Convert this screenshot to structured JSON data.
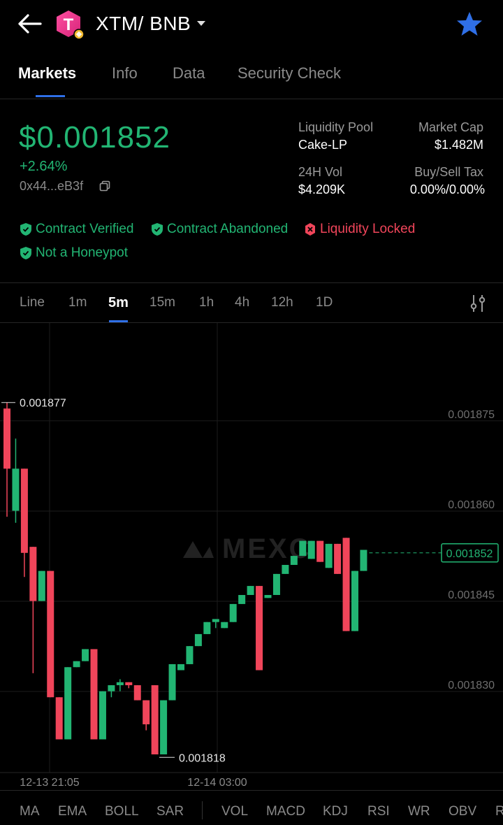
{
  "header": {
    "title": "XTM/ BNB",
    "logo_letter": "T",
    "starred": true
  },
  "tabs": [
    {
      "label": "Markets",
      "active": true
    },
    {
      "label": "Info",
      "active": false
    },
    {
      "label": "Data",
      "active": false
    },
    {
      "label": "Security Check",
      "active": false
    }
  ],
  "market": {
    "price": "$0.001852",
    "change": "+2.64%",
    "address": "0x44...eB3f",
    "liquidity_pool_label": "Liquidity Pool",
    "liquidity_pool_value": "Cake-LP",
    "market_cap_label": "Market Cap",
    "market_cap_value": "$1.482M",
    "vol_label": "24H Vol",
    "vol_value": "$4.209K",
    "tax_label": "Buy/Sell Tax",
    "tax_value": "0.00%/0.00%"
  },
  "badges": [
    {
      "label": "Contract Verified",
      "status": "ok"
    },
    {
      "label": "Contract Abandoned",
      "status": "ok"
    },
    {
      "label": "Liquidity Locked",
      "status": "bad"
    },
    {
      "label": "Not a Honeypot",
      "status": "ok"
    }
  ],
  "timeframes": [
    {
      "label": "Line",
      "active": false
    },
    {
      "label": "1m",
      "active": false
    },
    {
      "label": "5m",
      "active": true
    },
    {
      "label": "15m",
      "active": false
    },
    {
      "label": "1h",
      "active": false
    },
    {
      "label": "4h",
      "active": false
    },
    {
      "label": "12h",
      "active": false
    },
    {
      "label": "1D",
      "active": false
    }
  ],
  "indicators": [
    "MA",
    "EMA",
    "BOLL",
    "SAR",
    "VOL",
    "MACD",
    "KDJ",
    "RSI",
    "WR",
    "OBV",
    "R"
  ],
  "colors": {
    "up": "#22b573",
    "down": "#f0455a",
    "accent": "#2f6fe6",
    "background": "#000000"
  },
  "chart_data": {
    "type": "candlestick",
    "watermark": "MEXC",
    "y_ticks": [
      "0.001875",
      "0.001860",
      "0.001845",
      "0.001830"
    ],
    "ylim": [
      0.0018185,
      0.0018808
    ],
    "x_ticks": [
      "12-13 21:05",
      "12-14 03:00"
    ],
    "high_marker": "0.001877",
    "low_marker": "0.001818",
    "last_price": "0.001852",
    "candles": [
      {
        "o": 0.001876,
        "h": 0.001877,
        "l": 0.001858,
        "c": 0.001866
      },
      {
        "o": 0.001859,
        "h": 0.001871,
        "l": 0.001857,
        "c": 0.001866
      },
      {
        "o": 0.001866,
        "h": 0.001866,
        "l": 0.001848,
        "c": 0.001852
      },
      {
        "o": 0.001853,
        "h": 0.001853,
        "l": 0.001832,
        "c": 0.001844
      },
      {
        "o": 0.001844,
        "h": 0.001849,
        "l": 0.001844,
        "c": 0.001849
      },
      {
        "o": 0.001849,
        "h": 0.001849,
        "l": 0.001828,
        "c": 0.001828
      },
      {
        "o": 0.001828,
        "h": 0.001828,
        "l": 0.001821,
        "c": 0.001821
      },
      {
        "o": 0.001821,
        "h": 0.001833,
        "l": 0.001821,
        "c": 0.001833
      },
      {
        "o": 0.001833,
        "h": 0.001834,
        "l": 0.001833,
        "c": 0.001834
      },
      {
        "o": 0.001834,
        "h": 0.001836,
        "l": 0.001834,
        "c": 0.001836
      },
      {
        "o": 0.001836,
        "h": 0.001836,
        "l": 0.001821,
        "c": 0.001821
      },
      {
        "o": 0.001821,
        "h": 0.001829,
        "l": 0.001821,
        "c": 0.001829
      },
      {
        "o": 0.001829,
        "h": 0.00183,
        "l": 0.001828,
        "c": 0.00183
      },
      {
        "o": 0.00183,
        "h": 0.001831,
        "l": 0.001829,
        "c": 0.0018305
      },
      {
        "o": 0.0018305,
        "h": 0.0018305,
        "l": 0.0018295,
        "c": 0.00183
      },
      {
        "o": 0.00183,
        "h": 0.00183,
        "l": 0.0018275,
        "c": 0.0018275
      },
      {
        "o": 0.0018275,
        "h": 0.0018275,
        "l": 0.0018225,
        "c": 0.0018235
      },
      {
        "o": 0.00183,
        "h": 0.00183,
        "l": 0.0018185,
        "c": 0.0018185
      },
      {
        "o": 0.0018185,
        "h": 0.0018275,
        "l": 0.0018185,
        "c": 0.0018275
      },
      {
        "o": 0.0018275,
        "h": 0.0018335,
        "l": 0.0018275,
        "c": 0.0018335
      },
      {
        "o": 0.0018325,
        "h": 0.0018335,
        "l": 0.0018325,
        "c": 0.0018335
      },
      {
        "o": 0.0018335,
        "h": 0.0018365,
        "l": 0.0018335,
        "c": 0.0018365
      },
      {
        "o": 0.0018365,
        "h": 0.0018385,
        "l": 0.0018365,
        "c": 0.0018385
      },
      {
        "o": 0.0018385,
        "h": 0.0018405,
        "l": 0.0018385,
        "c": 0.0018405
      },
      {
        "o": 0.0018405,
        "h": 0.001841,
        "l": 0.0018395,
        "c": 0.001841
      },
      {
        "o": 0.0018395,
        "h": 0.0018405,
        "l": 0.0018395,
        "c": 0.0018405
      },
      {
        "o": 0.0018405,
        "h": 0.0018435,
        "l": 0.0018405,
        "c": 0.0018435
      },
      {
        "o": 0.0018435,
        "h": 0.001845,
        "l": 0.0018435,
        "c": 0.001845
      },
      {
        "o": 0.001845,
        "h": 0.0018465,
        "l": 0.001845,
        "c": 0.0018465
      },
      {
        "o": 0.0018465,
        "h": 0.0018465,
        "l": 0.0018325,
        "c": 0.0018325
      },
      {
        "o": 0.0018445,
        "h": 0.001845,
        "l": 0.0018445,
        "c": 0.001845
      },
      {
        "o": 0.001845,
        "h": 0.0018485,
        "l": 0.001845,
        "c": 0.0018485
      },
      {
        "o": 0.0018485,
        "h": 0.00185,
        "l": 0.0018485,
        "c": 0.00185
      },
      {
        "o": 0.00185,
        "h": 0.0018515,
        "l": 0.00185,
        "c": 0.0018515
      },
      {
        "o": 0.0018515,
        "h": 0.001854,
        "l": 0.0018515,
        "c": 0.001854
      },
      {
        "o": 0.001851,
        "h": 0.001854,
        "l": 0.001851,
        "c": 0.001854
      },
      {
        "o": 0.001854,
        "h": 0.001854,
        "l": 0.0018505,
        "c": 0.0018505
      },
      {
        "o": 0.0018495,
        "h": 0.0018535,
        "l": 0.0018495,
        "c": 0.0018535
      },
      {
        "o": 0.0018535,
        "h": 0.0018535,
        "l": 0.0018485,
        "c": 0.0018485
      },
      {
        "o": 0.0018545,
        "h": 0.0018545,
        "l": 0.001839,
        "c": 0.001839
      },
      {
        "o": 0.001839,
        "h": 0.001849,
        "l": 0.001839,
        "c": 0.001849
      },
      {
        "o": 0.001849,
        "h": 0.0018525,
        "l": 0.001849,
        "c": 0.0018525
      }
    ]
  }
}
